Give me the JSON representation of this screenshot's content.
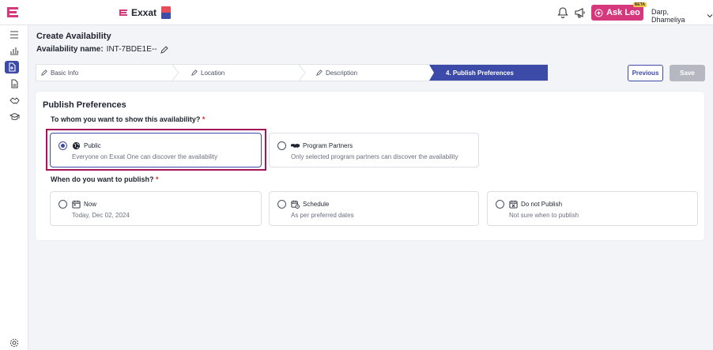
{
  "header": {
    "brand_name": "Exxat",
    "ask_leo_label": "Ask Leo",
    "ask_leo_badge": "BETA",
    "user_name": "Darp, Dhameliya"
  },
  "page": {
    "title": "Create Availability",
    "availability_name_label": "Availability name:",
    "availability_name_value": "INT-7BDE1E--"
  },
  "stepper": {
    "steps": [
      {
        "label": "Basic Info"
      },
      {
        "label": "Location"
      },
      {
        "label": "Description"
      },
      {
        "label": "4.  Publish Preferences"
      }
    ]
  },
  "actions": {
    "previous_label": "Previous",
    "save_label": "Save"
  },
  "publish": {
    "section_title": "Publish Preferences",
    "audience_question": "To whom you want to show this availability?",
    "audience_options": [
      {
        "title": "Public",
        "desc": "Everyone on Exxat One can discover the availability",
        "selected": true
      },
      {
        "title": "Program Partners",
        "desc": "Only selected program partners can discover the availability",
        "selected": false
      }
    ],
    "timing_question": "When do you want to publish?",
    "timing_options": [
      {
        "title": "Now",
        "desc": "Today, Dec 02, 2024",
        "selected": false
      },
      {
        "title": "Schedule",
        "desc": "As per preferred dates",
        "selected": false
      },
      {
        "title": "Do not Publish",
        "desc": "Not sure when to publish",
        "selected": false
      }
    ],
    "required_mark": "*"
  },
  "colors": {
    "accent": "#3d4ba8",
    "brand_pink": "#d6387e",
    "highlight": "#a3165a"
  }
}
